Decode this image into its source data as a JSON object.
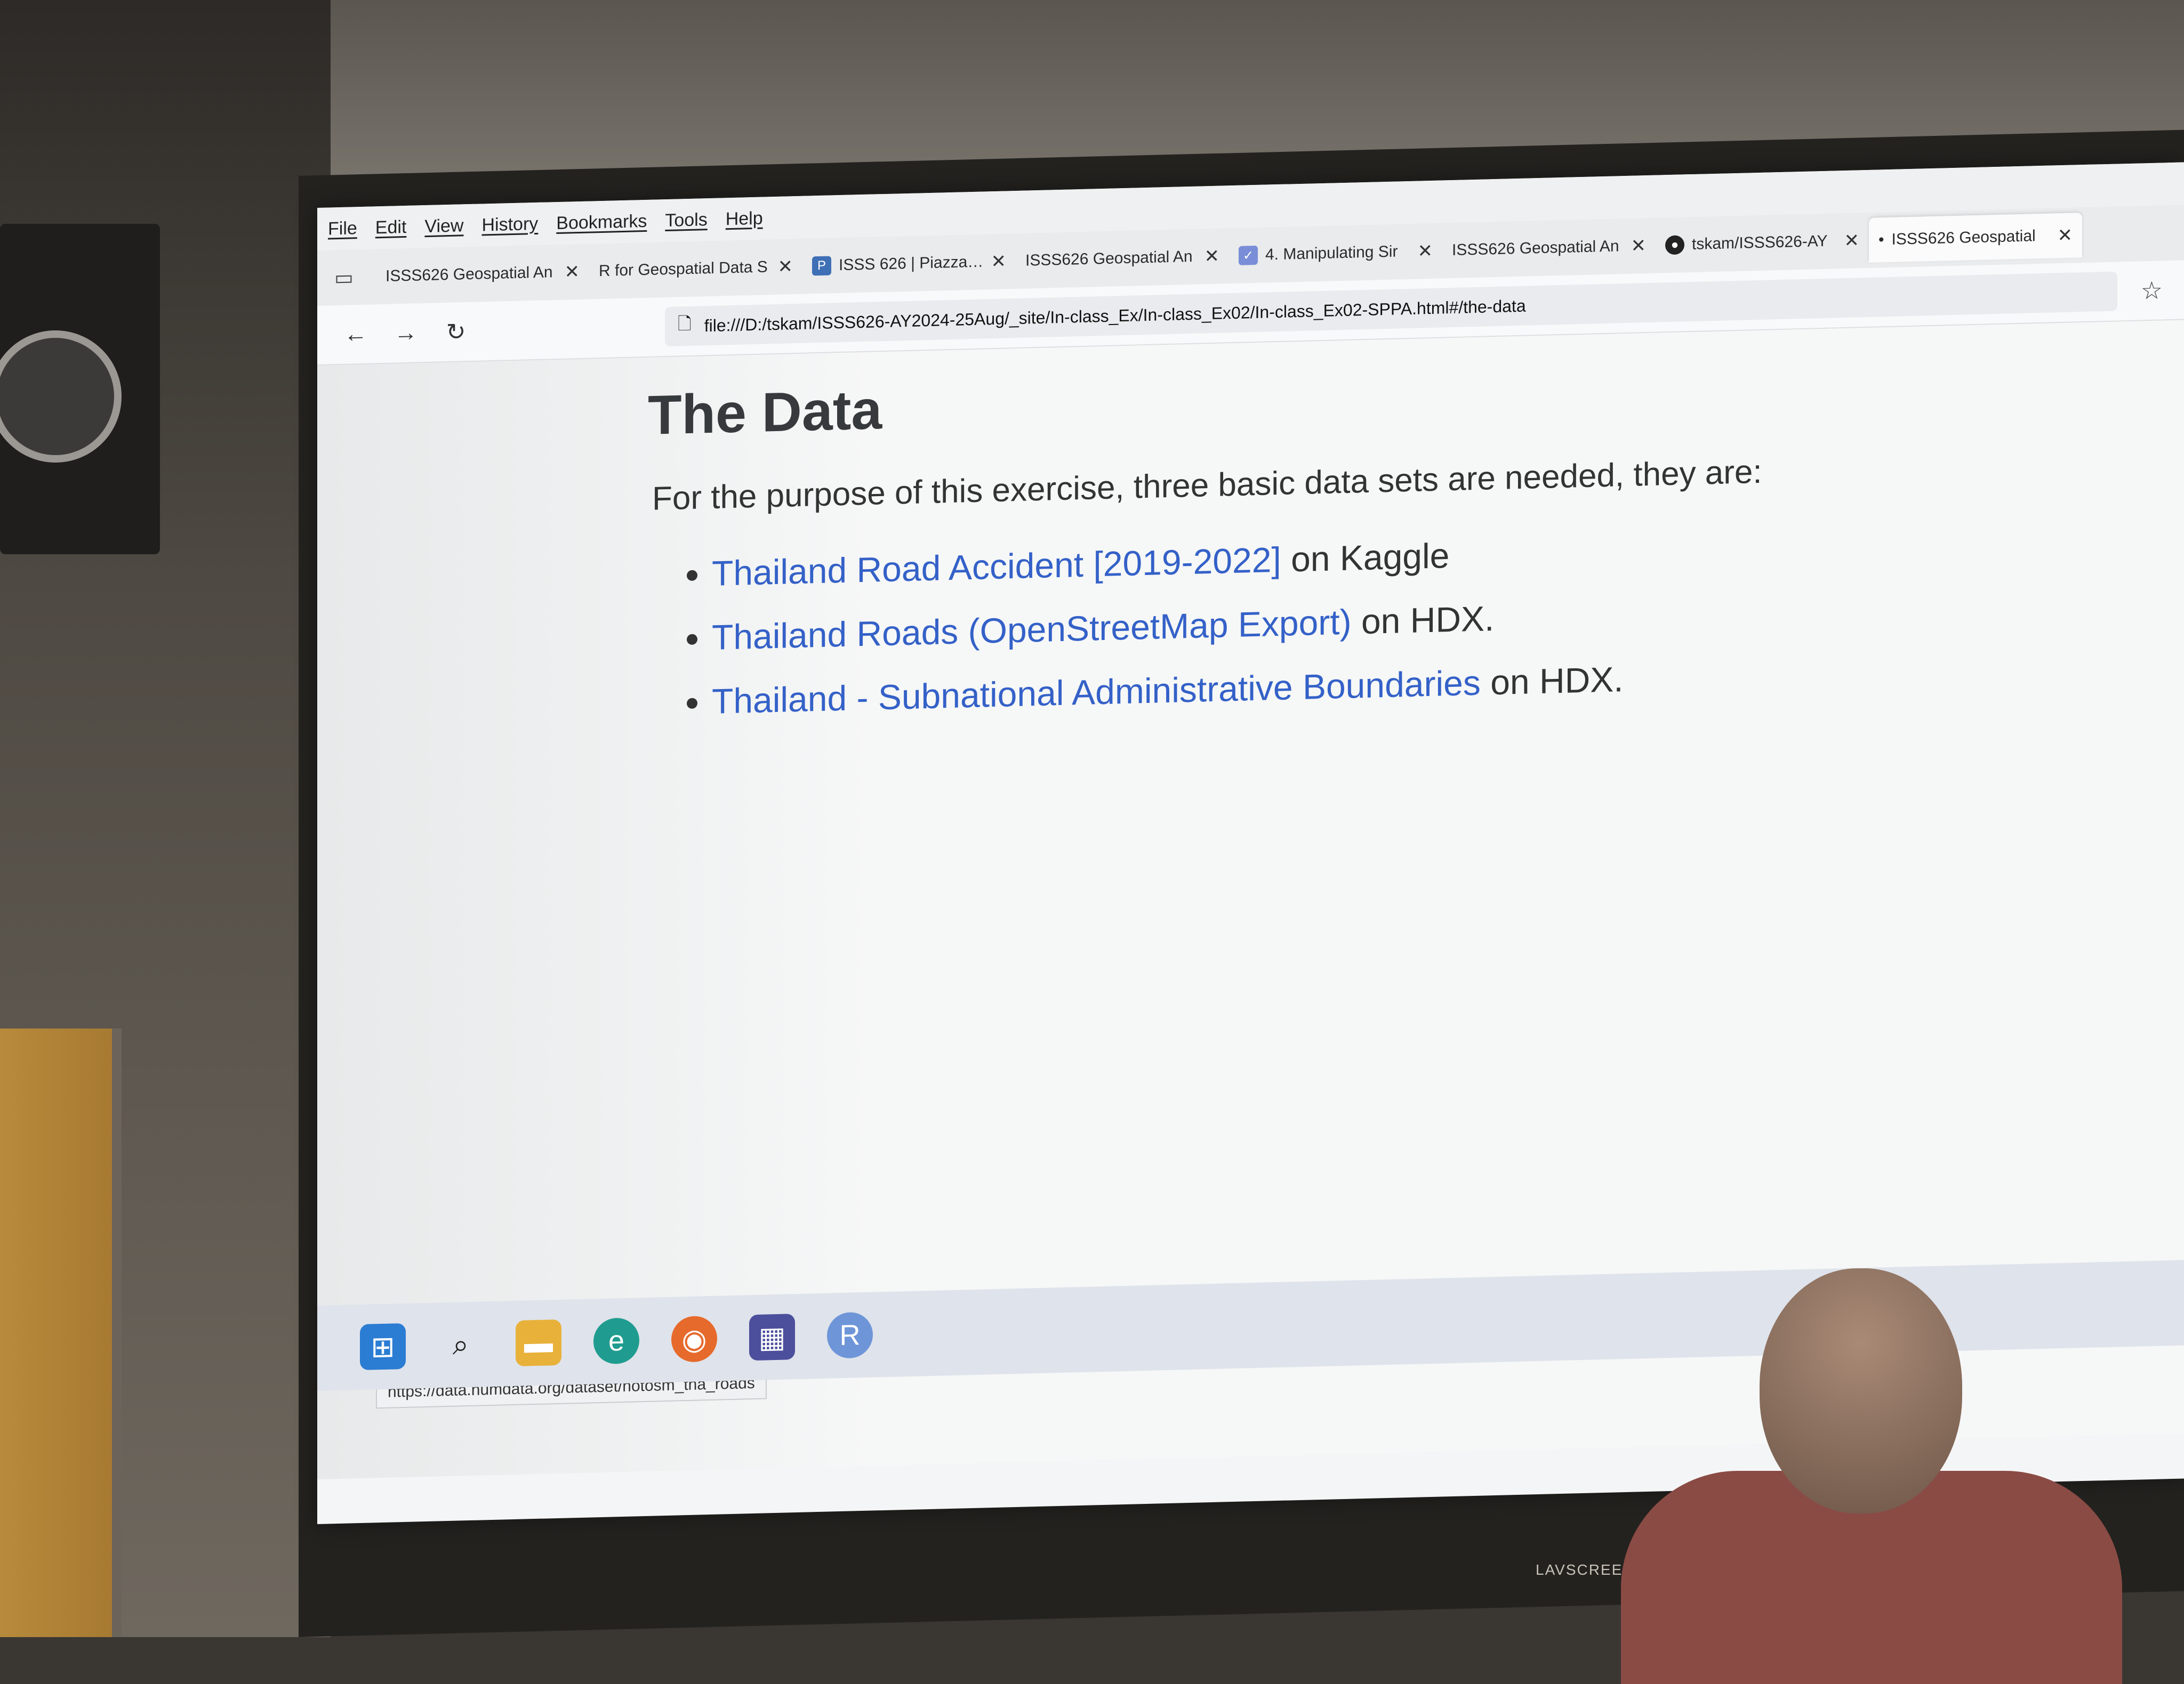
{
  "browser": {
    "menu": [
      "File",
      "Edit",
      "View",
      "History",
      "Bookmarks",
      "Tools",
      "Help"
    ],
    "tabs": [
      {
        "label": "ISSS626 Geospatial An",
        "icon": "none"
      },
      {
        "label": "R for Geospatial Data S",
        "icon": "none"
      },
      {
        "label": "ISSS 626 | Piazza Q",
        "icon": "piazza-icon"
      },
      {
        "label": "ISSS626 Geospatial An",
        "icon": "none"
      },
      {
        "label": "4. Manipulating Sir",
        "icon": "book-icon"
      },
      {
        "label": "ISSS626 Geospatial An",
        "icon": "none"
      },
      {
        "label": "tskam/ISSS626-AY",
        "icon": "github-icon"
      },
      {
        "label": "ISSS626 Geospatial",
        "icon": "dot-icon"
      }
    ],
    "url": "file:///D:/tskam/ISSS626-AY2024-25Aug/_site/In-class_Ex/In-class_Ex02/In-class_Ex02-SPPA.html#/the-data"
  },
  "page": {
    "title": "The Data",
    "intro": "For the purpose of this exercise, three basic data sets are needed, they are:",
    "items": [
      {
        "link": "Thailand Road Accident [2019-2022]",
        "suffix": " on Kaggle"
      },
      {
        "link": "Thailand Roads (OpenStreetMap Export)",
        "suffix": " on HDX."
      },
      {
        "link": "Thailand - Subnational Administrative Boundaries",
        "suffix": " on HDX."
      }
    ]
  },
  "status_url": "https://data.humdata.org/dataset/hotosm_tha_roads",
  "taskbar_icons": [
    "windows-start-icon",
    "search-icon",
    "file-explorer-icon",
    "edge-icon",
    "firefox-icon",
    "store-icon",
    "r-icon"
  ],
  "projector_brand": "LAVSCREEN",
  "colors": {
    "link": "#3461c8",
    "heading": "#373a3c",
    "screen_bg": "#f4f5f6"
  }
}
